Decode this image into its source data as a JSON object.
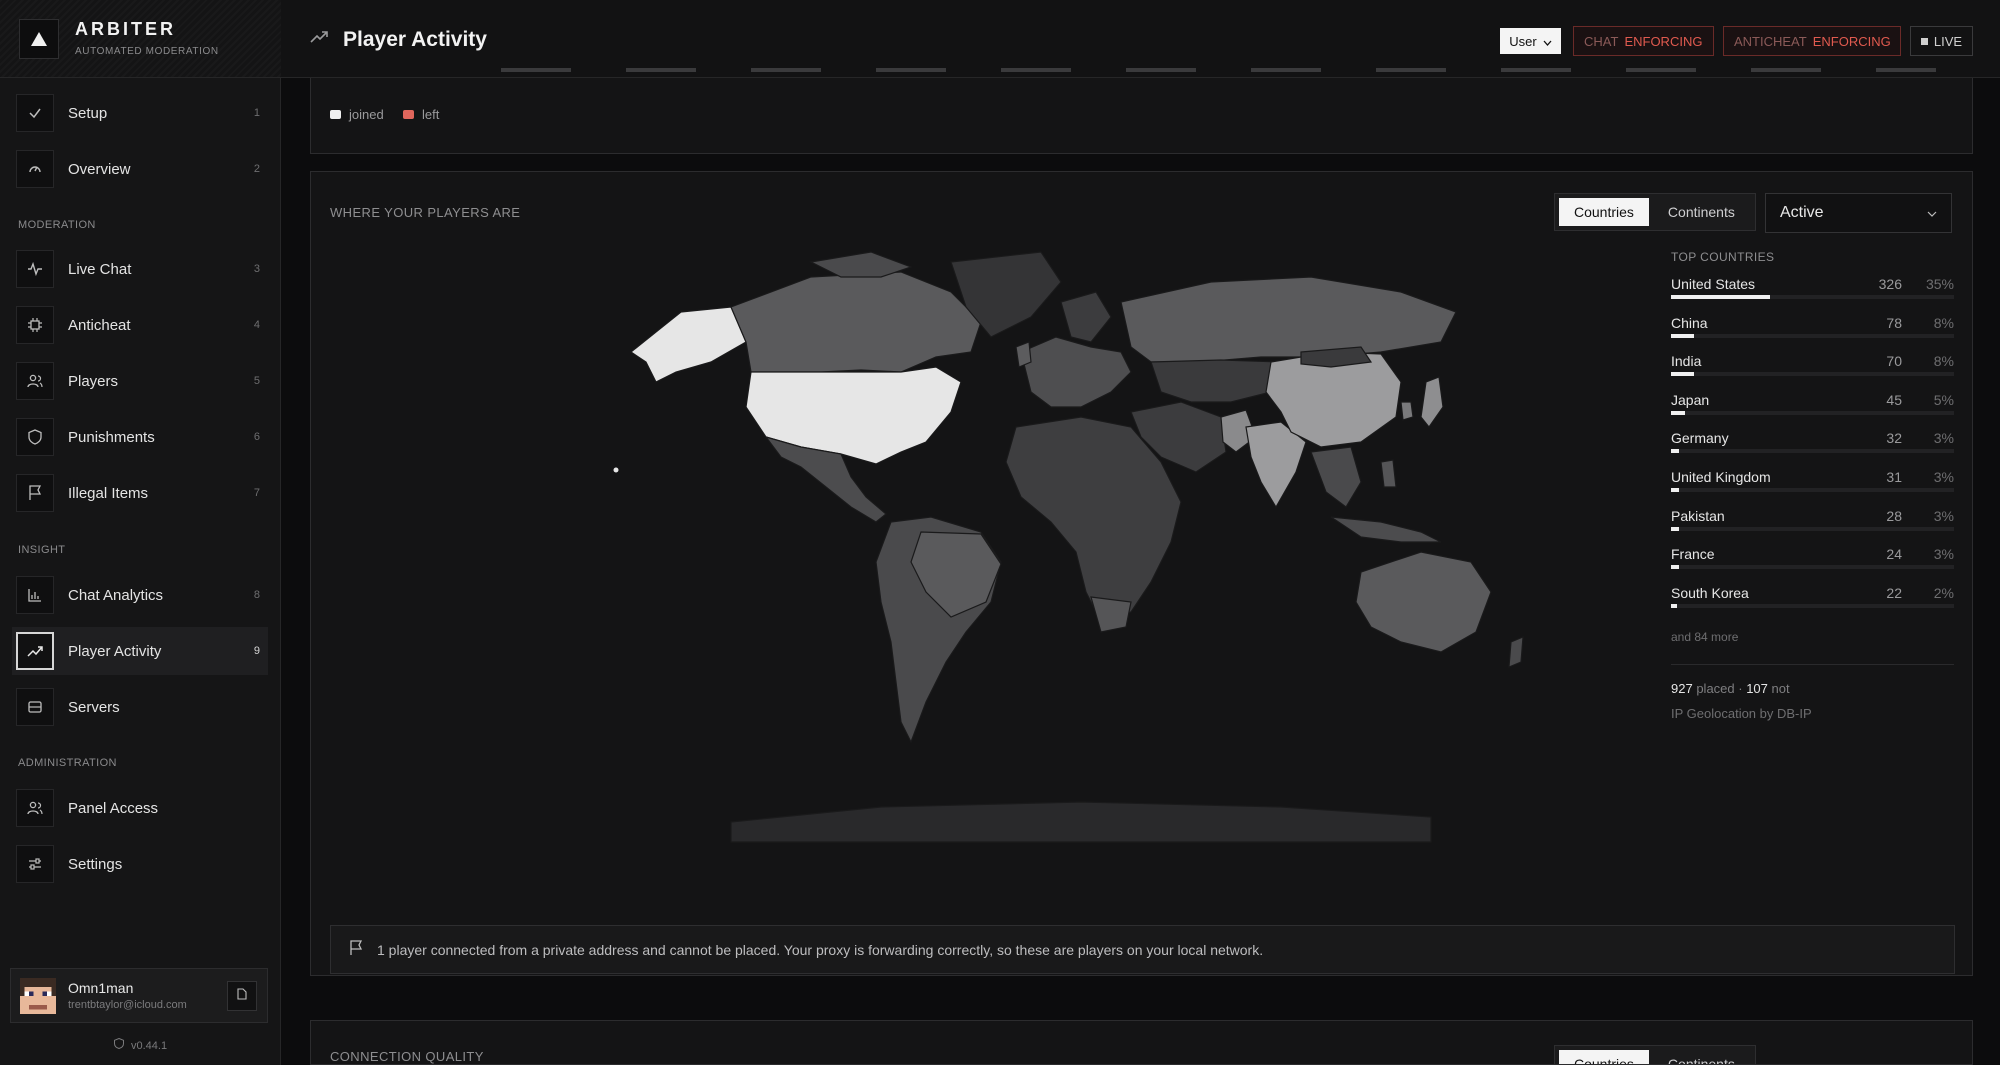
{
  "brand": {
    "title": "ARBITER",
    "subtitle": "AUTOMATED MODERATION"
  },
  "sidebar": {
    "items": [
      {
        "label": "Setup",
        "num": "1"
      },
      {
        "label": "Overview",
        "num": "2"
      },
      {
        "label": "Live Chat",
        "num": "3"
      },
      {
        "label": "Anticheat",
        "num": "4"
      },
      {
        "label": "Players",
        "num": "5"
      },
      {
        "label": "Punishments",
        "num": "6"
      },
      {
        "label": "Illegal Items",
        "num": "7"
      },
      {
        "label": "Chat Analytics",
        "num": "8"
      },
      {
        "label": "Player Activity",
        "num": "9"
      },
      {
        "label": "Servers",
        "num": ""
      },
      {
        "label": "Panel Access",
        "num": ""
      },
      {
        "label": "Settings",
        "num": ""
      }
    ],
    "sections": {
      "moderation": "MODERATION",
      "insight": "INSIGHT",
      "administration": "ADMINISTRATION"
    }
  },
  "user": {
    "name": "Omn1man",
    "email": "trentbtaylor@icloud.com"
  },
  "version": "v0.44.1",
  "header": {
    "title": "Player Activity",
    "role_select": "User",
    "chat_key": "CHAT",
    "chat_value": "ENFORCING",
    "anticheat_key": "ANTICHEAT",
    "anticheat_value": "ENFORCING",
    "live": "LIVE"
  },
  "activity_legend": {
    "joined": "joined",
    "left": "left",
    "joined_color": "#f0f0f0",
    "left_color": "#e0665c"
  },
  "map_panel": {
    "title": "WHERE YOUR PLAYERS ARE",
    "tabs": [
      "Countries",
      "Continents"
    ],
    "filter": "Active",
    "top_title": "TOP COUNTRIES",
    "countries": [
      {
        "name": "United States",
        "count": "326",
        "pct": "35%",
        "share": 35
      },
      {
        "name": "China",
        "count": "78",
        "pct": "8%",
        "share": 8
      },
      {
        "name": "India",
        "count": "70",
        "pct": "8%",
        "share": 8
      },
      {
        "name": "Japan",
        "count": "45",
        "pct": "5%",
        "share": 5
      },
      {
        "name": "Germany",
        "count": "32",
        "pct": "3%",
        "share": 3
      },
      {
        "name": "United Kingdom",
        "count": "31",
        "pct": "3%",
        "share": 3
      },
      {
        "name": "Pakistan",
        "count": "28",
        "pct": "3%",
        "share": 3
      },
      {
        "name": "France",
        "count": "24",
        "pct": "3%",
        "share": 3
      },
      {
        "name": "South Korea",
        "count": "22",
        "pct": "2%",
        "share": 2
      }
    ],
    "more": "and 84 more",
    "placed_count": "927",
    "placed_label": "placed",
    "not_count": "107",
    "not_label": "not",
    "geo_credit": "IP Geolocation by DB-IP",
    "notice": "1 player connected from a private address and cannot be placed. Your proxy is forwarding correctly, so these are players on your local network."
  },
  "connection_panel": {
    "title": "CONNECTION QUALITY",
    "tabs": [
      "Countries",
      "Continents"
    ]
  }
}
